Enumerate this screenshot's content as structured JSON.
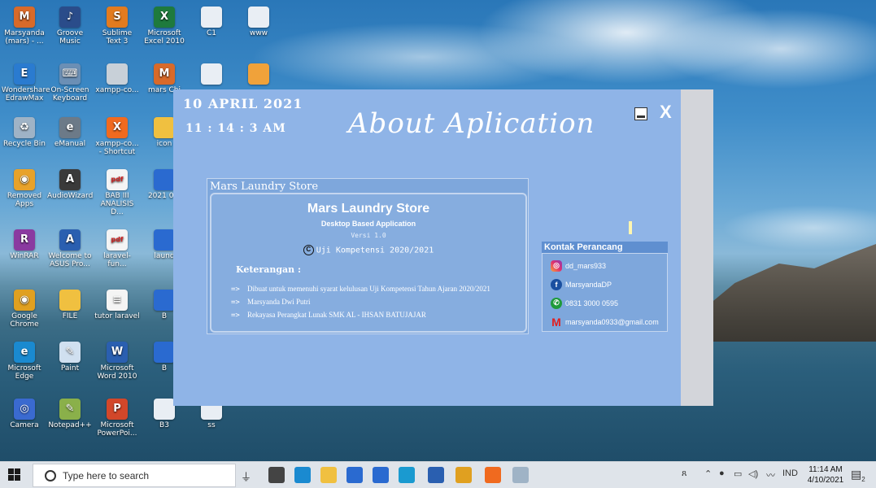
{
  "desktop": {
    "icons": [
      {
        "label": "Marsyanda (mars) - ...",
        "color": "#d86a2a",
        "glyph": "M"
      },
      {
        "label": "Groove Music",
        "color": "#2a4c8a",
        "glyph": "♪"
      },
      {
        "label": "Sublime Text 3",
        "color": "#e27b1f",
        "glyph": "S"
      },
      {
        "label": "Microsoft Excel 2010",
        "color": "#1e7a3d",
        "glyph": "X"
      },
      {
        "label": "C1",
        "color": "#e9eef4",
        "glyph": ""
      },
      {
        "label": "www",
        "color": "#e9eef4",
        "glyph": ""
      },
      {
        "label": "Wondershare EdrawMax",
        "color": "#2a7bd0",
        "glyph": "E"
      },
      {
        "label": "On-Screen Keyboard",
        "color": "#6b8fb5",
        "glyph": "⌨"
      },
      {
        "label": "xampp-co...",
        "color": "#c8d0d8",
        "glyph": ""
      },
      {
        "label": "mars Chi",
        "color": "#d86a2a",
        "glyph": "M"
      },
      {
        "label": "",
        "color": "#e9eef4",
        "glyph": ""
      },
      {
        "label": "",
        "color": "#f0a23a",
        "glyph": ""
      },
      {
        "label": "Recycle Bin",
        "color": "#9fb3c6",
        "glyph": "♻"
      },
      {
        "label": "eManual",
        "color": "#6c7a88",
        "glyph": "e"
      },
      {
        "label": "xampp-co... - Shortcut",
        "color": "#f06a1f",
        "glyph": "X"
      },
      {
        "label": "icon",
        "color": "#f0c040",
        "glyph": ""
      },
      {
        "label": "Removed Apps",
        "color": "#e8a22a",
        "glyph": "◉"
      },
      {
        "label": "AudioWizard",
        "color": "#3a3a3a",
        "glyph": "A"
      },
      {
        "label": "BAB III ANALISIS D...",
        "color": "#f4f4f4",
        "glyph": "pdf"
      },
      {
        "label": "2021 0...",
        "color": "#2a6ad0",
        "glyph": ""
      },
      {
        "label": "WinRAR",
        "color": "#8a3aa0",
        "glyph": "R"
      },
      {
        "label": "Welcome to ASUS Pro...",
        "color": "#2a5fb0",
        "glyph": "A"
      },
      {
        "label": "laravel-fun...",
        "color": "#f4f4f4",
        "glyph": "pdf"
      },
      {
        "label": "laund",
        "color": "#2a6ad0",
        "glyph": ""
      },
      {
        "label": "Google Chrome",
        "color": "#e0a020",
        "glyph": "◉"
      },
      {
        "label": "FILE",
        "color": "#f0c040",
        "glyph": ""
      },
      {
        "label": "tutor laravel",
        "color": "#f4f4f4",
        "glyph": "≡"
      },
      {
        "label": "B",
        "color": "#2a6ad0",
        "glyph": ""
      },
      {
        "label": "Microsoft Edge",
        "color": "#1a8ad0",
        "glyph": "e"
      },
      {
        "label": "Paint",
        "color": "#d0e0f0",
        "glyph": "✎"
      },
      {
        "label": "Microsoft Word 2010",
        "color": "#2a5fb0",
        "glyph": "W"
      },
      {
        "label": "B",
        "color": "#2a6ad0",
        "glyph": ""
      },
      {
        "label": "Camera",
        "color": "#3a6ad0",
        "glyph": "◎"
      },
      {
        "label": "Notepad++",
        "color": "#8ab04a",
        "glyph": "✎"
      },
      {
        "label": "Microsoft PowerPoi...",
        "color": "#d2472a",
        "glyph": "P"
      },
      {
        "label": "B3",
        "color": "#e9eef4",
        "glyph": ""
      },
      {
        "label": "ss",
        "color": "#e9eef4",
        "glyph": ""
      }
    ]
  },
  "app": {
    "date": "10 APRIL 2021",
    "time": "11 : 14 : 3  AM",
    "title": "About Aplication",
    "minimize_icon": "minimize-icon",
    "close_label": "X",
    "panel": {
      "header": "Mars Laundry Store",
      "product_name": "Mars Laundry Store",
      "subtitle": "Desktop Based Application",
      "version": "Versi 1.0",
      "copyright_symbol": "C",
      "copyright": "Uji Kompetensi 2020/2021",
      "ket_title": "Keterangan :",
      "arrow": "=>",
      "notes": [
        "Dibuat untuk memenuhi syarat kelulusan Uji Kompetensi Tahun Ajaran 2020/2021",
        "Marsyanda Dwi Putri",
        "Rekayasa Perangkat Lunak SMK AL - IHSAN BATUJAJAR"
      ]
    },
    "contact": {
      "title": "Kontak Perancang",
      "items": [
        {
          "icon": "instagram-icon",
          "glyph": "◎",
          "value": "dd_mars933"
        },
        {
          "icon": "facebook-icon",
          "glyph": "f",
          "value": "MarsyandaDP"
        },
        {
          "icon": "whatsapp-icon",
          "glyph": "✆",
          "value": "0831 3000 0595"
        },
        {
          "icon": "gmail-icon",
          "glyph": "M",
          "value": "marsyanda0933@gmail.com"
        }
      ]
    }
  },
  "taskbar": {
    "search_placeholder": "Type here to search",
    "language": "IND",
    "clock_time": "11:14 AM",
    "clock_date": "4/10/2021",
    "notification_count": "2",
    "apps": [
      {
        "icon": "task-view-icon",
        "color": "#444"
      },
      {
        "icon": "edge-icon",
        "color": "#1a8ad0"
      },
      {
        "icon": "file-explorer-icon",
        "color": "#f0c040"
      },
      {
        "icon": "store-icon",
        "color": "#2a6ad0"
      },
      {
        "icon": "mail-icon",
        "color": "#2a6ad0"
      },
      {
        "icon": "edge-new-icon",
        "color": "#1a9ad0"
      },
      {
        "icon": "word-icon",
        "color": "#2a5fb0"
      },
      {
        "icon": "chrome-icon",
        "color": "#e0a020"
      },
      {
        "icon": "xampp-icon",
        "color": "#f06a1f"
      },
      {
        "icon": "java-icon",
        "color": "#9fb3c6"
      }
    ]
  }
}
